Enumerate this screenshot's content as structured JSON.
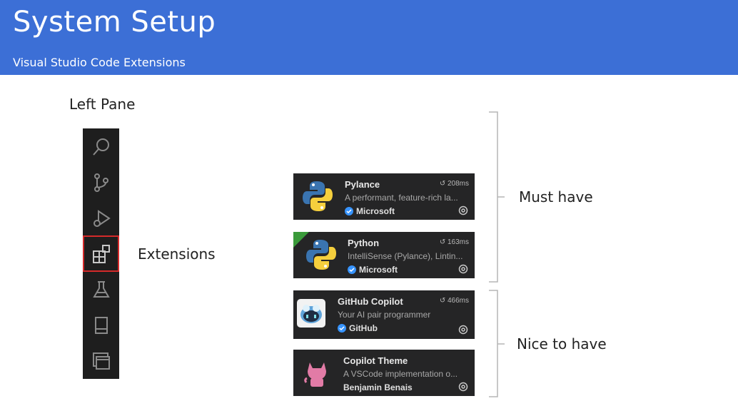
{
  "header": {
    "title": "System Setup",
    "subtitle": "Visual Studio Code Extensions"
  },
  "left_pane": {
    "label": "Left Pane",
    "icons": [
      "search-icon",
      "source-control-icon",
      "run-debug-icon",
      "extensions-icon",
      "testing-icon",
      "notebook-icon",
      "remote-explorer-icon"
    ],
    "selected": "extensions-icon"
  },
  "extensions_label": "Extensions",
  "groups": {
    "must_have": "Must have",
    "nice_to_have": "Nice to have"
  },
  "extensions": [
    {
      "name": "Pylance",
      "description": "A performant, feature-rich la...",
      "publisher": "Microsoft",
      "timing": "208ms",
      "verified": true
    },
    {
      "name": "Python",
      "description": "IntelliSense (Pylance), Lintin...",
      "publisher": "Microsoft",
      "timing": "163ms",
      "verified": true
    },
    {
      "name": "GitHub Copilot",
      "description": "Your AI pair programmer",
      "publisher": "GitHub",
      "timing": "466ms",
      "verified": true
    },
    {
      "name": "Copilot Theme",
      "description": "A VSCode implementation o...",
      "publisher": "Benjamin Benais",
      "timing": "",
      "verified": false
    }
  ],
  "colors": {
    "header_bg": "#3c6fd6",
    "activity_bar_bg": "#1e1e1e",
    "card_bg": "#252526",
    "selection_outline": "#d42a2a",
    "verified_badge": "#3794ff"
  }
}
